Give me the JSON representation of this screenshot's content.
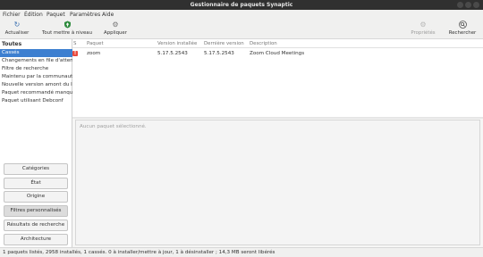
{
  "window": {
    "title": "Gestionnaire de paquets Synaptic"
  },
  "menubar": {
    "items": [
      "Fichier",
      "Édition",
      "Paquet",
      "Paramètres",
      "Aide"
    ]
  },
  "toolbar": {
    "reload": {
      "label": "Actualiser",
      "icon": "refresh-icon"
    },
    "mark_all_upgrades": {
      "label": "Tout mettre à niveau",
      "icon": "shield-upgrade-icon"
    },
    "apply": {
      "label": "Appliquer",
      "icon": "apply-gears-icon"
    },
    "properties": {
      "label": "Propriétés",
      "icon": "properties-gear-icon",
      "enabled": false
    },
    "search": {
      "label": "Rechercher",
      "icon": "search-icon"
    }
  },
  "sidebar": {
    "heading": "Toutes",
    "items": [
      "Cassés",
      "Changements en file d'attente",
      "Filtre de recherche",
      "Maintenu par la communauté",
      "Nouvelle version amont du lo…",
      "Paquet recommandé manquant",
      "Paquet utilisant Debconf"
    ],
    "selected": "Cassés",
    "filter_buttons": [
      "Catégories",
      "État",
      "Origine",
      "Filtres personnalisés",
      "Résultats de recherche",
      "Architecture"
    ],
    "active_filter": "Filtres personnalisés"
  },
  "package_list": {
    "columns": {
      "s": "S",
      "package": "Paquet",
      "installed": "Version installée",
      "latest": "Dernière version",
      "description": "Description"
    },
    "rows": [
      {
        "status_icon": "broken-package-icon",
        "package": "zoom",
        "installed": "5.17.5.2543",
        "latest": "5.17.5.2543",
        "description": "Zoom Cloud Meetings"
      }
    ]
  },
  "details": {
    "placeholder": "Aucun paquet sélectionné."
  },
  "statusbar": {
    "text": "1 paquets listés, 2958 installés, 1 cassés. 0 à installer/mettre à jour, 1 à désinstaller ; 14,3 MB seront libérés"
  },
  "colors": {
    "selection": "#3d7fd0",
    "broken": "#e84a3e",
    "titlebar": "#303030"
  }
}
